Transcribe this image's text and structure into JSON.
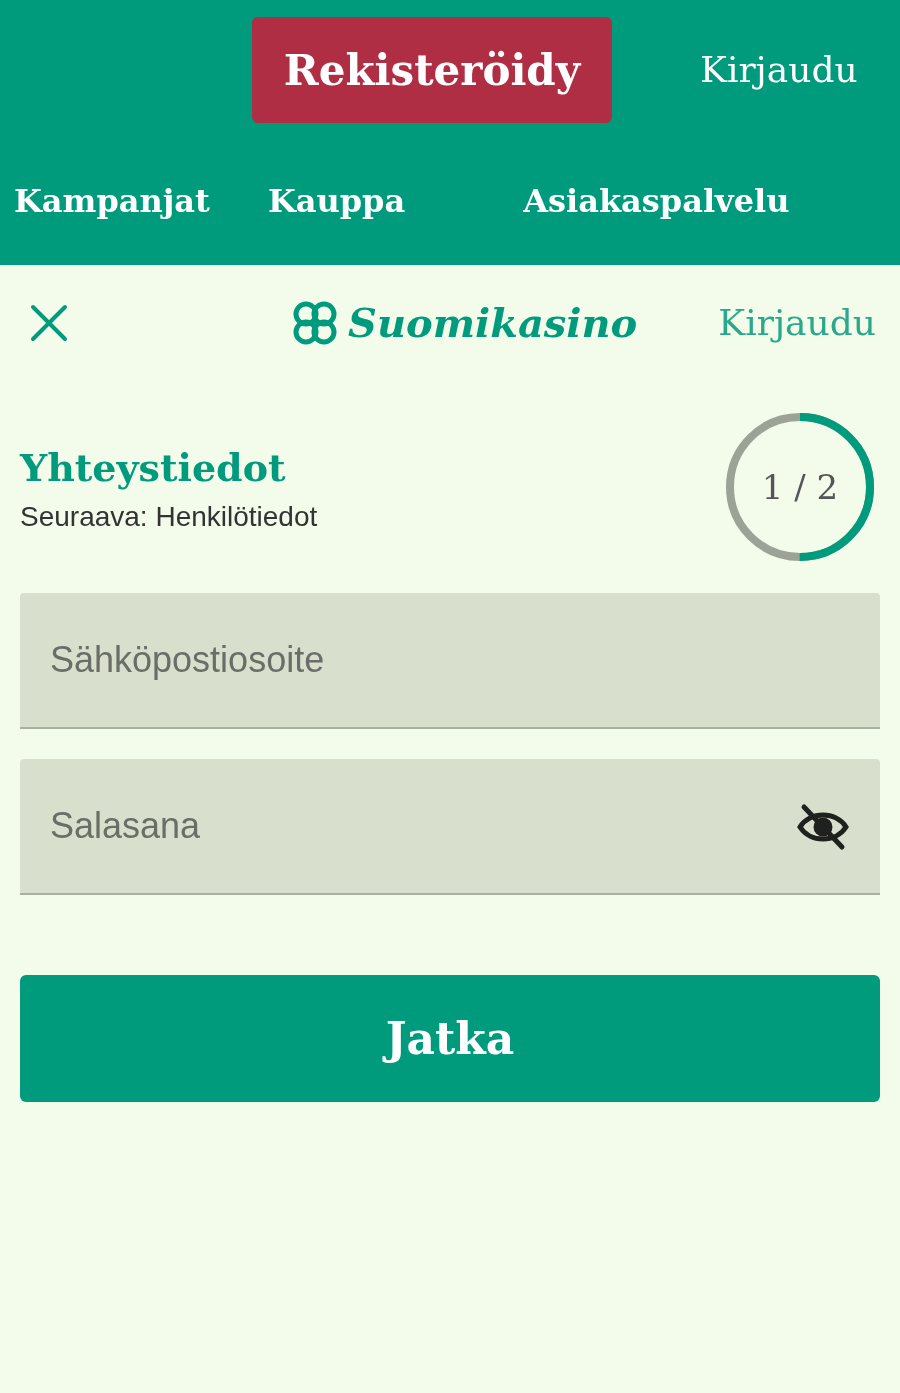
{
  "header": {
    "register_button": "Rekisteröidy",
    "login_link": "Kirjaudu"
  },
  "nav": [
    {
      "label": "Kampanjat"
    },
    {
      "label": "Kauppa"
    },
    {
      "label": "Asiakaspalvelu"
    }
  ],
  "topbar": {
    "logo": "Suomikasino",
    "login_link": "Kirjaudu"
  },
  "step": {
    "title": "Yhteystiedot",
    "next": "Seuraava: Henkilötiedot",
    "counter": "1 / 2",
    "level": 0.5
  },
  "fields": [
    {
      "placeholder": "Sähköpostiosoite",
      "kind": "email"
    },
    {
      "placeholder": "Salasana",
      "kind": "password"
    }
  ],
  "submit_button": "Jatka"
}
